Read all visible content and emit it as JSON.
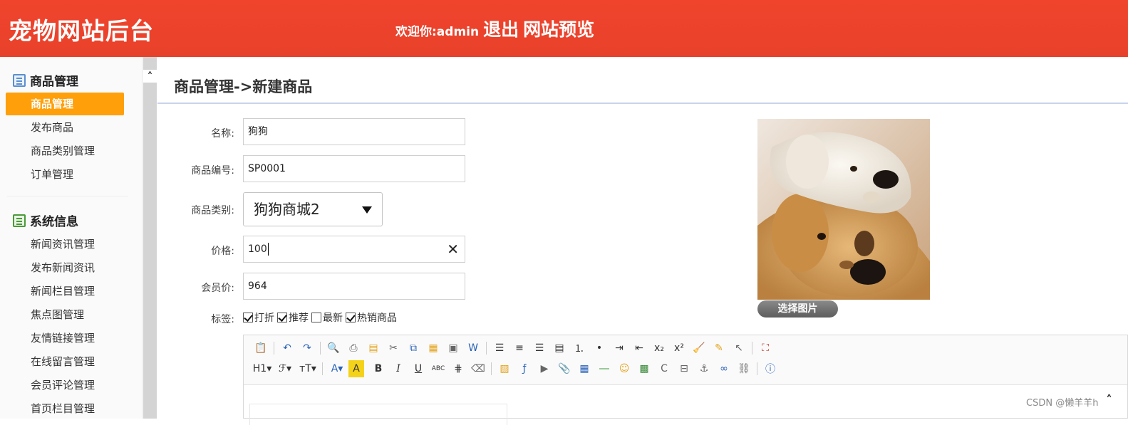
{
  "header": {
    "brand": "宠物网站后台",
    "welcome": "欢迎你:admin",
    "logout": "退出",
    "preview": "网站预览"
  },
  "sidebar": {
    "groups": [
      {
        "title": "商品管理",
        "icon": "list-icon",
        "items": [
          "商品管理",
          "发布商品",
          "商品类别管理",
          "订单管理"
        ]
      },
      {
        "title": "系统信息",
        "icon": "system-info-icon",
        "items": [
          "新闻资讯管理",
          "发布新闻资讯",
          "新闻栏目管理",
          "焦点图管理",
          "友情链接管理",
          "在线留言管理",
          "会员评论管理",
          "首页栏目管理"
        ]
      }
    ],
    "active_item": "商品管理"
  },
  "page": {
    "title": "商品管理->新建商品"
  },
  "form": {
    "name_label": "名称:",
    "name_value": "狗狗",
    "code_label": "商品编号:",
    "code_value": "SP0001",
    "category_label": "商品类别:",
    "category_value": "狗狗商城2",
    "price_label": "价格:",
    "price_value": "100",
    "member_price_label": "会员价:",
    "member_price_value": "964",
    "tags_label": "标签:",
    "tags": [
      {
        "label": "打折",
        "checked": true
      },
      {
        "label": "推荐",
        "checked": true
      },
      {
        "label": "最新",
        "checked": false
      },
      {
        "label": "热销商品",
        "checked": true
      }
    ],
    "choose_image": "选择图片"
  },
  "editor": {
    "row1_icons": [
      "paste-icon",
      "undo-icon",
      "redo-icon",
      "preview-icon",
      "print-icon",
      "template-icon",
      "cut-icon",
      "copy-icon",
      "paste-text-icon",
      "paste-plain-icon",
      "paste-word-icon",
      "align-left-icon",
      "align-center-icon",
      "align-right-icon",
      "align-justify-icon",
      "ordered-list-icon",
      "unordered-list-icon",
      "indent-icon",
      "outdent-icon",
      "subscript-icon",
      "superscript-icon",
      "clear-format-icon",
      "format-painter-icon",
      "select-all-icon",
      "fullscreen-icon"
    ],
    "row2_icons": [
      "heading-icon",
      "font-family-icon",
      "font-size-icon",
      "font-color-icon",
      "highlight-color-icon",
      "bold-icon",
      "italic-icon",
      "underline-icon",
      "strikethrough-icon",
      "line-height-icon",
      "remove-format-icon",
      "image-icon",
      "flash-icon",
      "media-icon",
      "attachment-icon",
      "table-icon",
      "horizontal-rule-icon",
      "emoticon-icon",
      "map-icon",
      "code-icon",
      "page-break-icon",
      "anchor-icon",
      "link-icon",
      "unlink-icon",
      "help-icon"
    ],
    "heading_label": "H1",
    "font_size_label": "тT",
    "strike_label": "ABC"
  },
  "watermark": "CSDN @懒羊羊h",
  "colors": {
    "header": "#e8412b",
    "active_nav": "#ff9f0a",
    "title_line": "#c8d4ec"
  }
}
